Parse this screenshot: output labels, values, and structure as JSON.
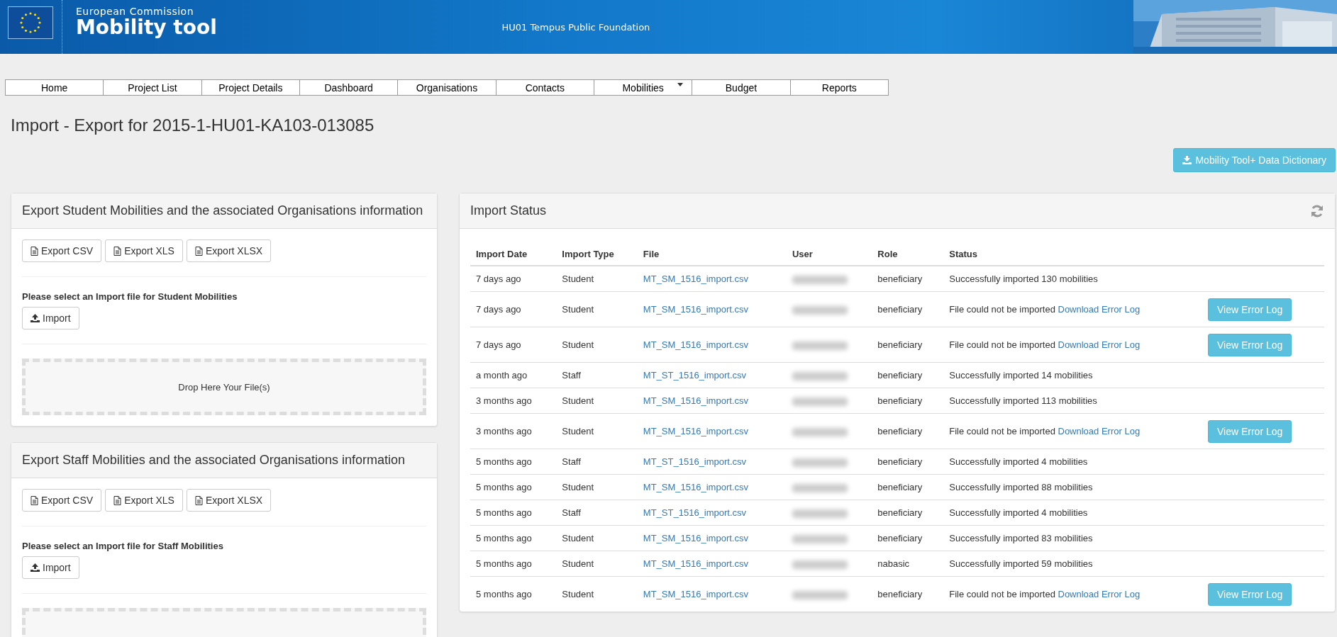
{
  "header": {
    "org_line": "European Commission",
    "app_name": "Mobility tool",
    "center_title": "HU01 Tempus Public Foundation"
  },
  "nav": [
    {
      "label": "Home",
      "has_menu": false
    },
    {
      "label": "Project List",
      "has_menu": false
    },
    {
      "label": "Project Details",
      "has_menu": false
    },
    {
      "label": "Dashboard",
      "has_menu": false
    },
    {
      "label": "Organisations",
      "has_menu": false
    },
    {
      "label": "Contacts",
      "has_menu": false
    },
    {
      "label": "Mobilities",
      "has_menu": true
    },
    {
      "label": "Budget",
      "has_menu": false
    },
    {
      "label": "Reports",
      "has_menu": false
    }
  ],
  "page_title": "Import - Export for 2015-1-HU01-KA103-013085",
  "dictionary_button": "Mobility Tool+ Data Dictionary",
  "export_panels": [
    {
      "title": "Export Student Mobilities and the associated Organisations information",
      "export_buttons": [
        "Export CSV",
        "Export XLS",
        "Export XLSX"
      ],
      "import_prompt": "Please select an Import file for Student Mobilities",
      "import_button": "Import",
      "drop_zone": "Drop Here Your File(s)"
    },
    {
      "title": "Export Staff Mobilities and the associated Organisations information",
      "export_buttons": [
        "Export CSV",
        "Export XLS",
        "Export XLSX"
      ],
      "import_prompt": "Please select an Import file for Staff Mobilities",
      "import_button": "Import"
    }
  ],
  "import_status": {
    "title": "Import Status",
    "columns": [
      "Import Date",
      "Import Type",
      "File",
      "User",
      "Role",
      "Status"
    ],
    "rows": [
      {
        "kind": "success",
        "date": "7 days ago",
        "type": "Student",
        "file": "MT_SM_1516_import.csv",
        "role": "beneficiary",
        "status": "Successfully imported 130 mobilities"
      },
      {
        "kind": "error",
        "date": "7 days ago",
        "type": "Student",
        "file": "MT_SM_1516_import.csv",
        "role": "beneficiary",
        "status": "File could not be imported",
        "link": "Download Error Log",
        "button": "View Error Log"
      },
      {
        "kind": "error",
        "date": "7 days ago",
        "type": "Student",
        "file": "MT_SM_1516_import.csv",
        "role": "beneficiary",
        "status": "File could not be imported",
        "link": "Download Error Log",
        "button": "View Error Log"
      },
      {
        "kind": "success",
        "date": "a month ago",
        "type": "Staff",
        "file": "MT_ST_1516_import.csv",
        "role": "beneficiary",
        "status": "Successfully imported 14 mobilities"
      },
      {
        "kind": "success",
        "date": "3 months ago",
        "type": "Student",
        "file": "MT_SM_1516_import.csv",
        "role": "beneficiary",
        "status": "Successfully imported 113 mobilities"
      },
      {
        "kind": "error",
        "date": "3 months ago",
        "type": "Student",
        "file": "MT_SM_1516_import.csv",
        "role": "beneficiary",
        "status": "File could not be imported",
        "link": "Download Error Log",
        "button": "View Error Log"
      },
      {
        "kind": "success",
        "date": "5 months ago",
        "type": "Staff",
        "file": "MT_ST_1516_import.csv",
        "role": "beneficiary",
        "status": "Successfully imported 4 mobilities"
      },
      {
        "kind": "success",
        "date": "5 months ago",
        "type": "Student",
        "file": "MT_SM_1516_import.csv",
        "role": "beneficiary",
        "status": "Successfully imported 88 mobilities"
      },
      {
        "kind": "success",
        "date": "5 months ago",
        "type": "Staff",
        "file": "MT_ST_1516_import.csv",
        "role": "beneficiary",
        "status": "Successfully imported 4 mobilities"
      },
      {
        "kind": "success",
        "date": "5 months ago",
        "type": "Student",
        "file": "MT_SM_1516_import.csv",
        "role": "beneficiary",
        "status": "Successfully imported 83 mobilities"
      },
      {
        "kind": "success",
        "date": "5 months ago",
        "type": "Student",
        "file": "MT_SM_1516_import.csv",
        "role": "nabasic",
        "status": "Successfully imported 59 mobilities"
      },
      {
        "kind": "error",
        "date": "5 months ago",
        "type": "Student",
        "file": "MT_SM_1516_import.csv",
        "role": "beneficiary",
        "status": "File could not be imported",
        "link": "Download Error Log",
        "button": "View Error Log"
      }
    ]
  }
}
